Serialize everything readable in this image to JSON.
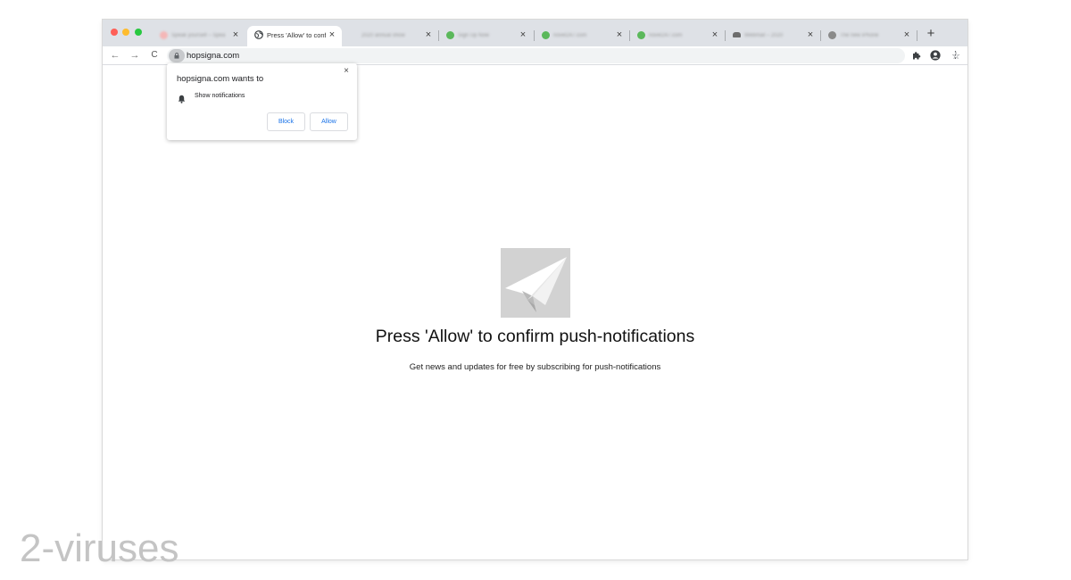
{
  "browser": {
    "tabs": [
      {
        "title": "Speak yourself – Speak",
        "favicon_color": "#f4b7b7",
        "close": "×",
        "active": false
      },
      {
        "title": "Press 'Allow' to confirm",
        "favicon_color": "#3c4043",
        "close": "×",
        "active": true
      },
      {
        "title": "2020 annual show",
        "favicon_color": "",
        "close": "×",
        "active": false
      },
      {
        "title": "Sign Up Now",
        "favicon_color": "#5bb85b",
        "close": "×",
        "active": false
      },
      {
        "title": "novel247.com",
        "favicon_color": "#5bb85b",
        "close": "×",
        "active": false
      },
      {
        "title": "novel247.com",
        "favicon_color": "#5bb85b",
        "close": "×",
        "active": false
      },
      {
        "title": "Webmail – 2020",
        "favicon_color": "#6d6d6d",
        "close": "×",
        "active": false
      },
      {
        "title": "The new iPhone",
        "favicon_color": "#8a8a8a",
        "close": "×",
        "active": false
      }
    ],
    "new_tab": "+",
    "nav": {
      "back": "←",
      "forward": "→",
      "reload": "C"
    },
    "address": "hopsigna.com",
    "star": "☆",
    "menu": "⋮",
    "icons": [
      "lock-icon",
      "star-icon",
      "extensions-puzzle-icon",
      "profile-icon",
      "menu-icon"
    ]
  },
  "permission_popup": {
    "title": "hopsigna.com wants to",
    "permission": "Show notifications",
    "block_label": "Block",
    "allow_label": "Allow",
    "close": "×"
  },
  "page": {
    "headline": "Press 'Allow' to confirm push-notifications",
    "subline": "Get news and updates for free by subscribing for push-notifications",
    "image_icon": "paper-plane-icon"
  },
  "watermark": "2-viruses",
  "colors": {
    "accent": "#1a73e8",
    "tabstrip": "#dee1e6",
    "hero_bg": "#d2d2d2"
  }
}
